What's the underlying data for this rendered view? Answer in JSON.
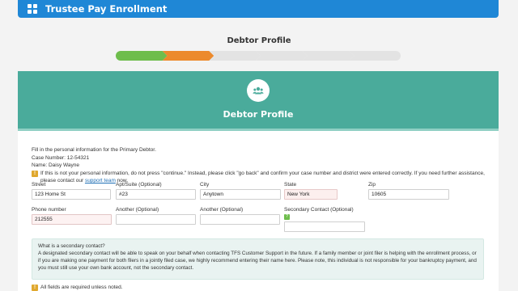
{
  "app": {
    "title": "Trustee Pay Enrollment",
    "logo_icon": "grid-logo-icon"
  },
  "page": {
    "title": "Debtor Profile"
  },
  "progress": {
    "total_steps": 6,
    "current_step": 2,
    "colors": {
      "done": "#6ebd4c",
      "current": "#ec8a2c",
      "pending": "#e3e3e3"
    }
  },
  "card": {
    "title": "Debtor Profile",
    "icon": "users-icon",
    "header_color": "#4aab9b"
  },
  "info": {
    "intro": "Fill in the personal information for the Primary Debtor.",
    "case_number": "Case Number: 12-54321",
    "name": "Name: Daisy Wayne",
    "warning_before_link": "If this is not your personal information, do not press \"continue.\" Instead, please click \"go back\" and confirm your case number and district were entered correctly. If you need further assistance, please contact our ",
    "warning_link": "support team",
    "warning_after_link": " now."
  },
  "form": {
    "street": {
      "label": "Street",
      "value": "123 Home St"
    },
    "apt": {
      "label": "Apt/Suite (Optional)",
      "value": "#23"
    },
    "city": {
      "label": "City",
      "value": "Anytown"
    },
    "state": {
      "label": "State",
      "value": "New York"
    },
    "zip": {
      "label": "Zip",
      "value": "10605"
    },
    "phone": {
      "label": "Phone number",
      "value": "212555"
    },
    "another1": {
      "label": "Another (Optional)",
      "value": ""
    },
    "another2": {
      "label": "Another (Optional)",
      "value": ""
    },
    "secondary": {
      "label": "Secondary Contact (Optional)",
      "value": ""
    }
  },
  "note": {
    "title": "What is a secondary contact?",
    "body": "A designated secondary contact will be able to speak on your behalf when contacting TFS Customer Support in the future. If a family member or joint filer is helping with the enrollment process, or if you are making one payment for both filers in a jointly filed case, we highly recommend entering their name here. Please note, this individual is not responsible for your bankruptcy payment, and you must still use your own bank account, not the secondary contact."
  },
  "footer": {
    "required_note": "All fields are required unless noted."
  }
}
